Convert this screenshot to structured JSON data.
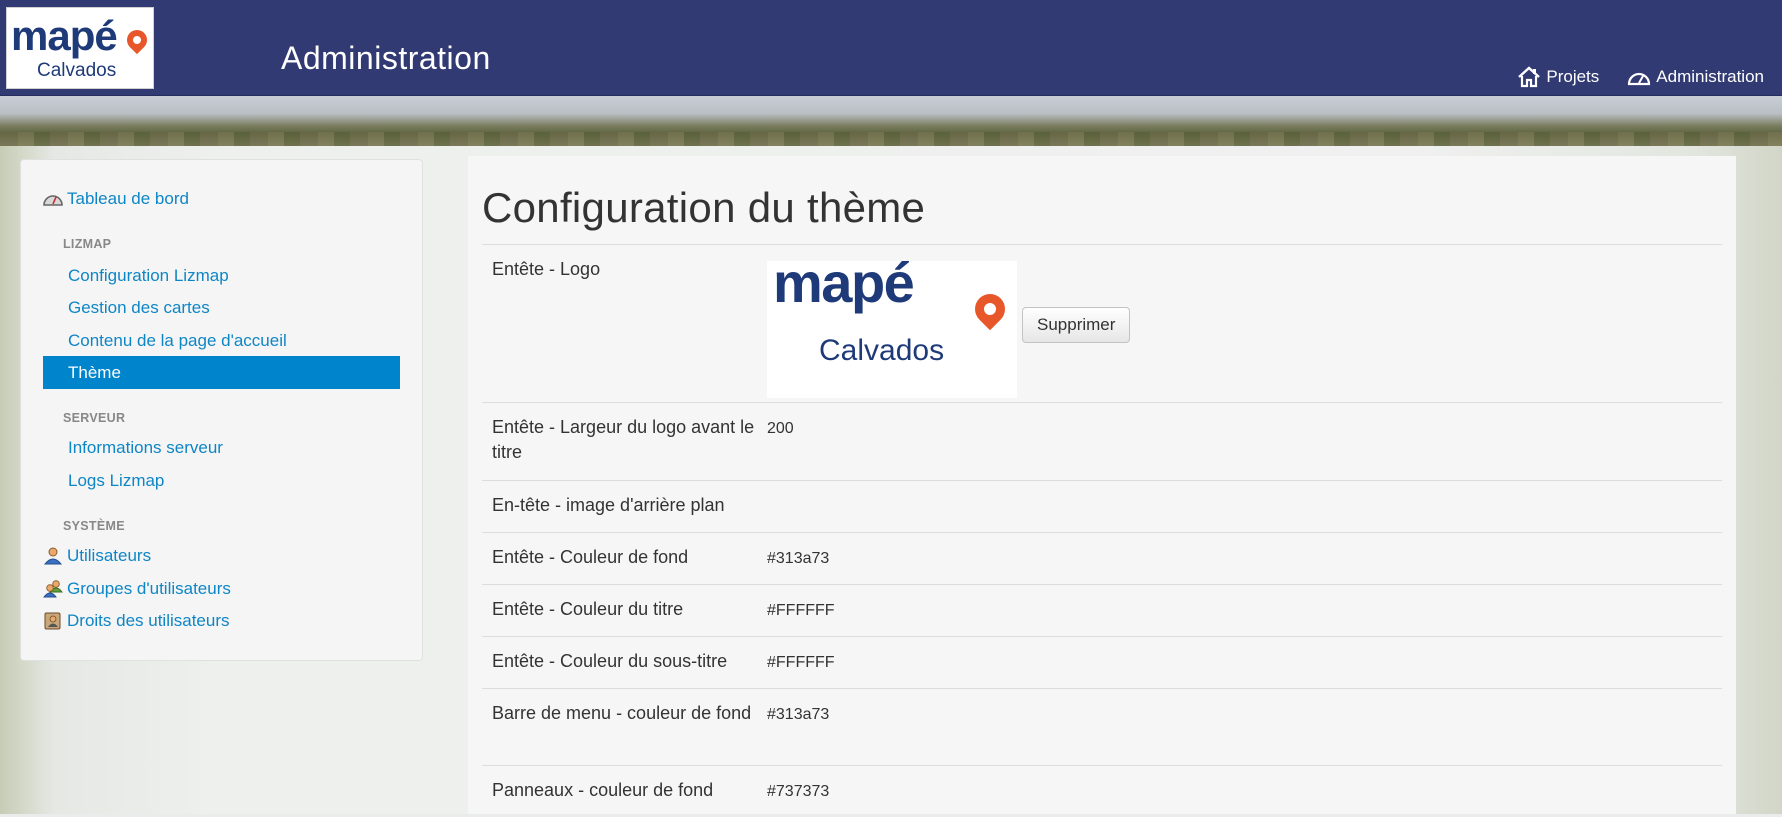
{
  "header": {
    "logo_top": "mapé",
    "logo_bottom": "Calvados",
    "title": "Administration",
    "nav": [
      {
        "label": "Projets",
        "icon": "home-icon"
      },
      {
        "label": "Administration",
        "icon": "dashboard-icon"
      }
    ]
  },
  "sidebar": {
    "dashboard": "Tableau de bord",
    "section_lizmap": "LIZMAP",
    "lizmap_items": [
      "Configuration Lizmap",
      "Gestion des cartes",
      "Contenu de la page d'accueil",
      "Thème"
    ],
    "section_serveur": "SERVEUR",
    "serveur_items": [
      "Informations serveur",
      "Logs Lizmap"
    ],
    "section_systeme": "SYSTÈME",
    "systeme_items": [
      "Utilisateurs",
      "Groupes d'utilisateurs",
      "Droits des utilisateurs"
    ]
  },
  "main": {
    "title": "Configuration du thème",
    "delete_button": "Supprimer",
    "rows": [
      {
        "label": "Entête - Logo",
        "value": ""
      },
      {
        "label": "Entête - Largeur du logo avant le titre",
        "value": "200"
      },
      {
        "label": "En-tête - image d'arrière plan",
        "value": ""
      },
      {
        "label": "Entête - Couleur de fond",
        "value": "#313a73"
      },
      {
        "label": "Entête - Couleur du titre",
        "value": "#FFFFFF"
      },
      {
        "label": "Entête - Couleur du sous-titre",
        "value": "#FFFFFF"
      },
      {
        "label": "Barre de menu - couleur de fond",
        "value": "#313a73"
      },
      {
        "label": "Panneaux - couleur de fond",
        "value": "#737373"
      }
    ]
  },
  "colors": {
    "header_bg": "#313a73",
    "link": "#0e86c6",
    "active": "#0084cc",
    "logo_blue": "#1e3a78",
    "logo_orange": "#e8572a"
  }
}
